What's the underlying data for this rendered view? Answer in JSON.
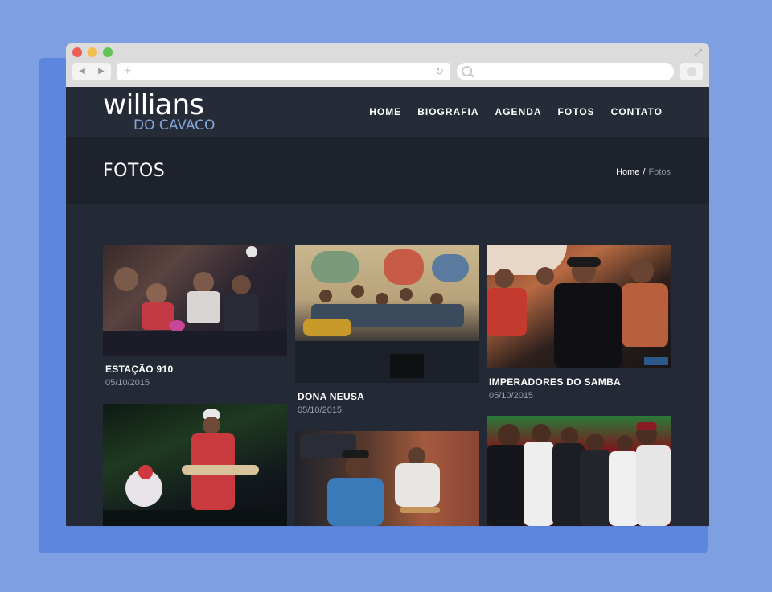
{
  "browser": {
    "back_icon": "◀",
    "forward_icon": "▶",
    "new_tab_icon": "+",
    "reload_icon": "↻",
    "fullscreen_icon": "⤢"
  },
  "site": {
    "logo_main": "willians",
    "logo_sub": "DO CAVACO",
    "menu": [
      "HOME",
      "BIOGRAFIA",
      "AGENDA",
      "FOTOS",
      "CONTATO"
    ]
  },
  "page": {
    "title": "FOTOS",
    "breadcrumb_home": "Home",
    "breadcrumb_sep": "/",
    "breadcrumb_current": "Fotos"
  },
  "gallery": {
    "items": [
      {
        "title": "ESTAÇÃO 910",
        "date": "05/10/2015"
      },
      {
        "title": "DONA NEUSA",
        "date": "05/10/2015"
      },
      {
        "title": "IMPERADORES DO SAMBA",
        "date": "05/10/2015"
      },
      {
        "title": "",
        "date": ""
      },
      {
        "title": "",
        "date": ""
      },
      {
        "title": "",
        "date": ""
      }
    ]
  },
  "colors": {
    "background": "#7f9fe3",
    "header": "#262c37",
    "banner": "#1e222c",
    "content": "#242a35",
    "logo_accent": "#84a6d8"
  }
}
